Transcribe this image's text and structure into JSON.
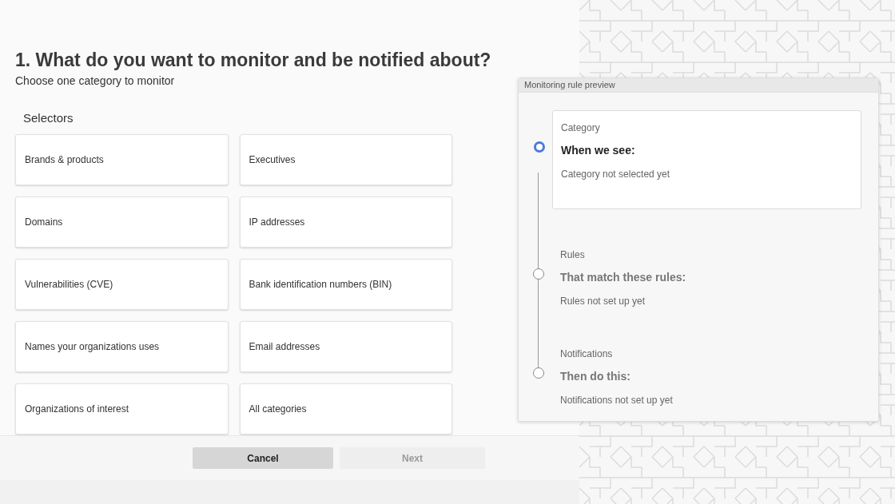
{
  "heading": "1. What do you want to monitor and be notified about?",
  "subheading": "Choose one category to monitor",
  "selectors": {
    "title": "Selectors",
    "options": [
      {
        "label": "Brands & products",
        "selected": false
      },
      {
        "label": "Executives",
        "selected": false
      },
      {
        "label": "Domains",
        "selected": false
      },
      {
        "label": "IP addresses",
        "selected": false
      },
      {
        "label": "Vulnerabilities (CVE)",
        "selected": false
      },
      {
        "label": "Bank identification numbers (BIN)",
        "selected": false
      },
      {
        "label": "Names your organizations uses",
        "selected": false
      },
      {
        "label": "Email addresses",
        "selected": false
      },
      {
        "label": "Organizations of interest",
        "selected": false
      },
      {
        "label": "All categories",
        "selected": false
      }
    ]
  },
  "buttons": [
    {
      "label": "Cancel",
      "disabled": false
    },
    {
      "label": "Next",
      "disabled": true
    }
  ],
  "preview": {
    "title": "Monitoring rule preview",
    "steps": [
      {
        "label": "Category",
        "title": "When we see:",
        "status": "Category not selected yet",
        "active": true
      },
      {
        "label": "Rules",
        "title": "That match these rules:",
        "status": "Rules not set up yet",
        "active": false
      },
      {
        "label": "Notifications",
        "title": "Then do this:",
        "status": "Notifications not set up yet",
        "active": false
      }
    ]
  }
}
